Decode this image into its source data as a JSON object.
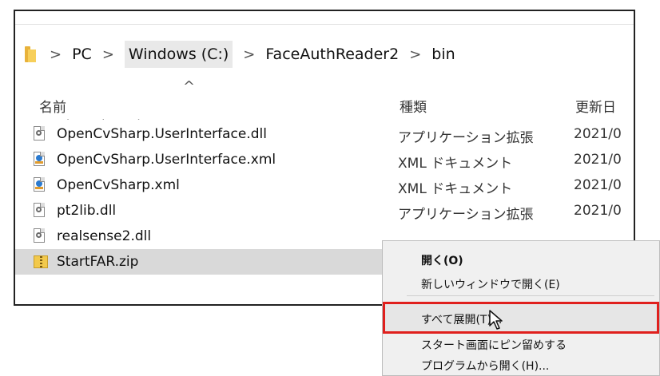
{
  "address": {
    "folder_icon": "folder-icon",
    "crumbs": [
      "PC",
      "Windows (C:)",
      "FaceAuthReader2",
      "bin"
    ],
    "separator": ">"
  },
  "header": {
    "sort_indicator": "^",
    "columns": [
      "名前",
      "種類",
      "更新日"
    ]
  },
  "files": [
    {
      "name": "OpenCvSharp.UserInterface.dll",
      "type": "アプリケーション拡張",
      "date": "2021/0",
      "icon": "dll-file-icon"
    },
    {
      "name": "OpenCvSharp.UserInterface.xml",
      "type": "XML ドキュメント",
      "date": "2021/0",
      "icon": "xml-file-icon"
    },
    {
      "name": "OpenCvSharp.xml",
      "type": "XML ドキュメント",
      "date": "2021/0",
      "icon": "xml-file-icon"
    },
    {
      "name": "pt2lib.dll",
      "type": "アプリケーション拡張",
      "date": "2021/0",
      "icon": "dll-file-icon"
    },
    {
      "name": "realsense2.dll",
      "type": "",
      "date": "",
      "icon": "dll-file-icon"
    },
    {
      "name": "StartFAR.zip",
      "type": "",
      "date": "",
      "icon": "zip-folder-icon",
      "selected": true
    }
  ],
  "context_menu": {
    "items": [
      "開く(O)",
      "新しいウィンドウで開く(E)",
      "すべて展開(T)...",
      "スタート画面にピン留めする",
      "プログラムから開く(H)..."
    ],
    "highlight_color": "#e0201d"
  }
}
